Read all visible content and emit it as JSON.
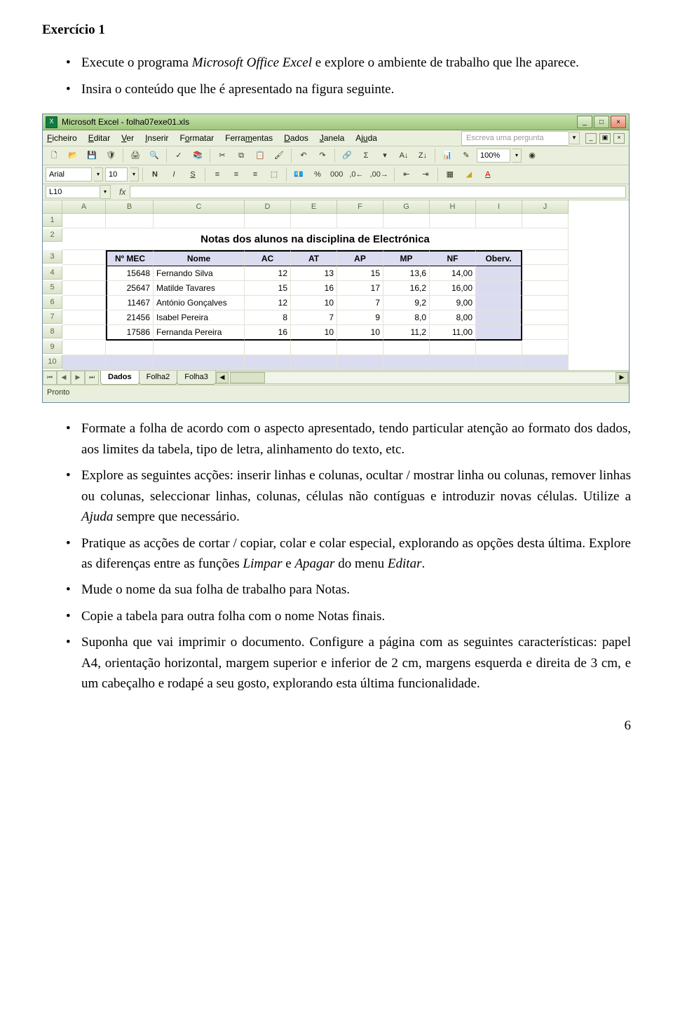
{
  "doc": {
    "exercise_title": "Exercício 1",
    "bullets_top": [
      {
        "pre": "Execute o programa ",
        "it": "Microsoft Office Excel",
        "post": " e explore o ambiente de trabalho que lhe aparece."
      },
      {
        "pre": "Insira o conteúdo que lhe é apresentado na figura seguinte.",
        "it": "",
        "post": ""
      }
    ],
    "bullets_bottom": [
      "Formate a folha de acordo com o aspecto apresentado, tendo particular atenção ao formato dos dados, aos limites da tabela, tipo de letra, alinhamento do texto, etc.",
      "Explore as seguintes acções: inserir linhas e colunas, ocultar / mostrar linha ou colunas, remover linhas ou colunas, seleccionar linhas, colunas, células não contíguas e introduzir novas células. Utilize a __IT__Ajuda__/IT__ sempre que necessário.",
      "Pratique as acções de cortar / copiar, colar e colar especial, explorando as opções desta última. Explore as diferenças entre as funções __IT__Limpar__/IT__ e __IT__Apagar__/IT__ do menu __IT__Editar__/IT__.",
      "Mude o nome da sua folha de trabalho para Notas.",
      "Copie a tabela para outra folha com o nome Notas finais.",
      "Suponha que vai imprimir o documento. Configure a página com as seguintes características: papel A4, orientação horizontal, margem superior e inferior de 2 cm, margens esquerda e direita de 3 cm, e um cabeçalho e rodapé a seu gosto, explorando esta última funcionalidade."
    ],
    "page_number": "6"
  },
  "excel": {
    "title": "Microsoft Excel - folha07exe01.xls",
    "ask_placeholder": "Escreva uma pergunta",
    "menus": [
      "Ficheiro",
      "Editar",
      "Ver",
      "Inserir",
      "Formatar",
      "Ferramentas",
      "Dados",
      "Janela",
      "Ajuda"
    ],
    "font_name": "Arial",
    "font_size": "10",
    "zoom": "100%",
    "name_box": "L10",
    "fx_label": "fx",
    "columns": [
      "A",
      "B",
      "C",
      "D",
      "E",
      "F",
      "G",
      "H",
      "I",
      "J"
    ],
    "row_numbers": [
      "1",
      "2",
      "3",
      "4",
      "5",
      "6",
      "7",
      "8",
      "9",
      "10"
    ],
    "sheet_title": "Notas dos alunos na disciplina de Electrónica",
    "header": [
      "Nº MEC",
      "Nome",
      "AC",
      "AT",
      "AP",
      "MP",
      "NF",
      "Oberv."
    ],
    "rows": [
      [
        "15648",
        "Fernando Silva",
        "12",
        "13",
        "15",
        "13,6",
        "14,00",
        ""
      ],
      [
        "25647",
        "Matilde Tavares",
        "15",
        "16",
        "17",
        "16,2",
        "16,00",
        ""
      ],
      [
        "11467",
        "António Gonçalves",
        "12",
        "10",
        "7",
        "9,2",
        "9,00",
        ""
      ],
      [
        "21456",
        "Isabel Pereira",
        "8",
        "7",
        "9",
        "8,0",
        "8,00",
        ""
      ],
      [
        "17586",
        "Fernanda Pereira",
        "16",
        "10",
        "10",
        "11,2",
        "11,00",
        ""
      ]
    ],
    "tabs": [
      "Dados",
      "Folha2",
      "Folha3"
    ],
    "status": "Pronto"
  }
}
